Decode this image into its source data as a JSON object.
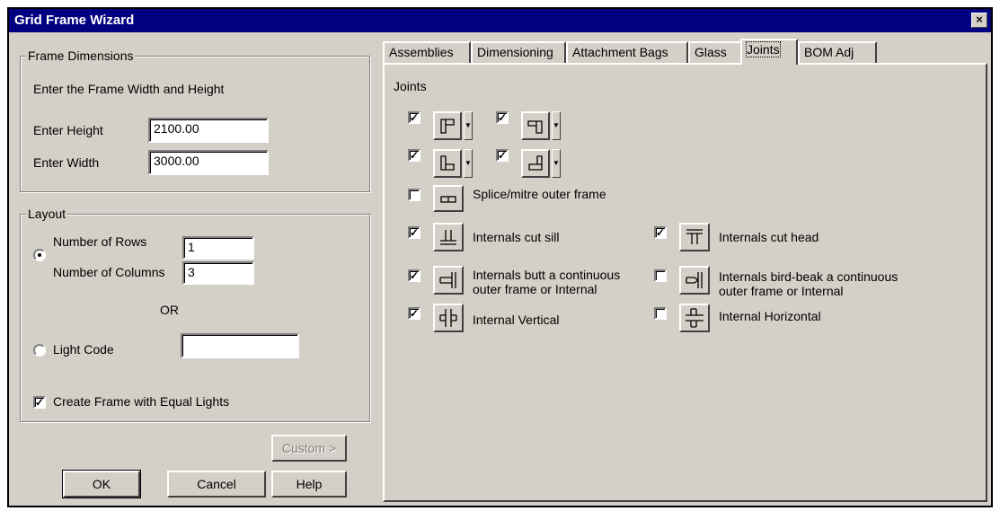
{
  "window": {
    "title": "Grid Frame Wizard",
    "close_glyph": "×"
  },
  "frame_dimensions": {
    "legend": "Frame Dimensions",
    "instruction": "Enter the Frame Width and Height",
    "height_label": "Enter Height",
    "height_value": "2100.00",
    "width_label": "Enter Width",
    "width_value": "3000.00"
  },
  "layout": {
    "legend": "Layout",
    "rows_label": "Number of Rows",
    "rows_value": "1",
    "columns_label": "Number of Columns",
    "columns_value": "3",
    "or_label": "OR",
    "light_code_label": "Light Code",
    "light_code_value": "",
    "equal_lights_label": "Create Frame with Equal Lights",
    "rows_selected": true,
    "equal_lights_checked": true
  },
  "buttons": {
    "custom": "Custom >",
    "ok": "OK",
    "cancel": "Cancel",
    "help": "Help"
  },
  "tabs": [
    {
      "label": "Assemblies"
    },
    {
      "label": "Dimensioning"
    },
    {
      "label": "Attachment Bags"
    },
    {
      "label": "Glass"
    },
    {
      "label": "Joints"
    },
    {
      "label": "BOM Adj"
    }
  ],
  "active_tab": "Joints",
  "joints": {
    "heading": "Joints",
    "splice_label": "Splice/mitre outer frame",
    "internals_cut_sill": "Internals cut sill",
    "internals_cut_head": "Internals cut head",
    "internals_butt_line1": "Internals butt a continuous",
    "internals_butt_line2": "outer frame or Internal",
    "internals_birdbeak_line1": "Internals bird-beak a continuous",
    "internals_birdbeak_line2": "outer frame or Internal",
    "internal_vertical": "Internal Vertical",
    "internal_horizontal": "Internal Horizontal",
    "check_glyph": "✓"
  }
}
